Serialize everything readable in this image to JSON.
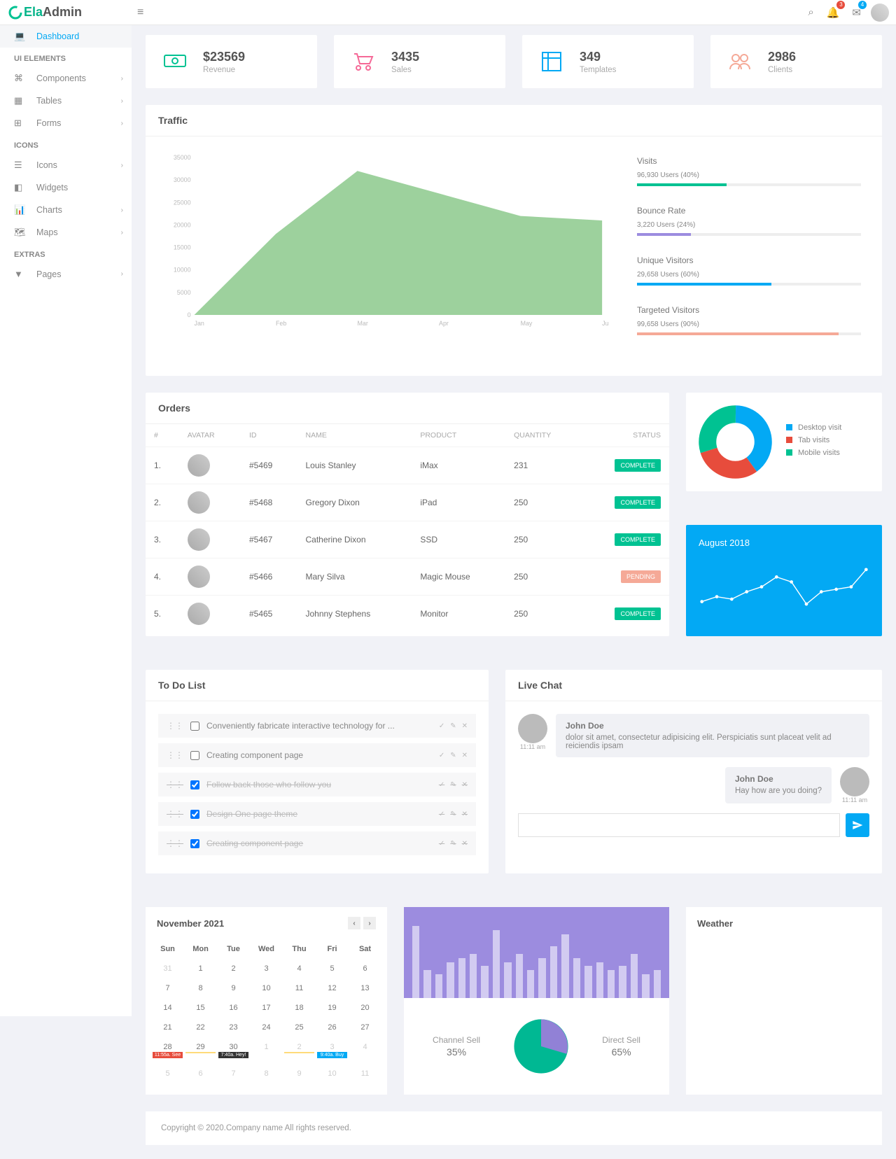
{
  "app": {
    "logo_front": "Ela",
    "logo_back": "Admin"
  },
  "badges": {
    "bell": "3",
    "mail": "4"
  },
  "sidebar": {
    "dashboard": "Dashboard",
    "groups": [
      {
        "title": "UI ELEMENTS",
        "items": [
          {
            "label": "Components",
            "chev": true,
            "icon": "⌘"
          },
          {
            "label": "Tables",
            "chev": true,
            "icon": "▦"
          },
          {
            "label": "Forms",
            "chev": true,
            "icon": "⊞"
          }
        ]
      },
      {
        "title": "ICONS",
        "items": [
          {
            "label": "Icons",
            "chev": true,
            "icon": "☰"
          },
          {
            "label": "Widgets",
            "chev": false,
            "icon": "◧"
          },
          {
            "label": "Charts",
            "chev": true,
            "icon": "📊"
          },
          {
            "label": "Maps",
            "chev": true,
            "icon": "🗺"
          }
        ]
      },
      {
        "title": "EXTRAS",
        "items": [
          {
            "label": "Pages",
            "chev": true,
            "icon": "▼"
          }
        ]
      }
    ]
  },
  "stats": [
    {
      "value": "$23569",
      "label": "Revenue",
      "color": "#00c292"
    },
    {
      "value": "3435",
      "label": "Sales",
      "color": "#f56997"
    },
    {
      "value": "349",
      "label": "Templates",
      "color": "#03a9f4"
    },
    {
      "value": "2986",
      "label": "Clients",
      "color": "#f5a997"
    }
  ],
  "traffic": {
    "title": "Traffic",
    "metrics": [
      {
        "title": "Visits",
        "text": "96,930 Users (40%)",
        "pct": 40,
        "color": "#00c292"
      },
      {
        "title": "Bounce Rate",
        "text": "3,220 Users (24%)",
        "pct": 24,
        "color": "#9c8cdf"
      },
      {
        "title": "Unique Visitors",
        "text": "29,658 Users (60%)",
        "pct": 60,
        "color": "#03a9f4"
      },
      {
        "title": "Targeted Visitors",
        "text": "99,658 Users (90%)",
        "pct": 90,
        "color": "#f5a997"
      }
    ]
  },
  "chart_data": {
    "traffic_area": {
      "type": "area",
      "ylim": [
        0,
        35000
      ],
      "yticks": [
        0,
        5000,
        10000,
        15000,
        20000,
        25000,
        30000,
        35000
      ],
      "categories": [
        "Jan",
        "Feb",
        "Mar",
        "Apr",
        "May",
        "Jun"
      ],
      "values": [
        0,
        18000,
        32000,
        27000,
        22000,
        21000
      ]
    },
    "donut": {
      "type": "pie",
      "series": [
        {
          "name": "Desktop visit",
          "value": 40,
          "color": "#03a9f4"
        },
        {
          "name": "Tab visits",
          "value": 30,
          "color": "#e74c3c"
        },
        {
          "name": "Mobile visits",
          "value": 30,
          "color": "#00c292"
        }
      ]
    },
    "august_line": {
      "type": "line",
      "title": "August 2018",
      "values": [
        30,
        40,
        35,
        50,
        60,
        80,
        70,
        25,
        50,
        55,
        60,
        95
      ]
    },
    "bars": {
      "type": "bar",
      "values": [
        90,
        35,
        30,
        45,
        50,
        55,
        40,
        85,
        45,
        55,
        35,
        50,
        65,
        80,
        50,
        40,
        45,
        35,
        40,
        55,
        30,
        35
      ]
    },
    "sell_pie": {
      "type": "pie",
      "series": [
        {
          "name": "Channel Sell",
          "label": "35%",
          "value": 35,
          "color": "#9181d6"
        },
        {
          "name": "Direct Sell",
          "label": "65%",
          "value": 65,
          "color": "#00b893"
        }
      ]
    }
  },
  "orders": {
    "title": "Orders",
    "columns": [
      "#",
      "AVATAR",
      "ID",
      "NAME",
      "PRODUCT",
      "QUANTITY",
      "STATUS"
    ],
    "rows": [
      {
        "n": "1.",
        "id": "#5469",
        "name": "Louis Stanley",
        "product": "iMax",
        "qty": "231",
        "status": "COMPLETE",
        "cls": "sb-green"
      },
      {
        "n": "2.",
        "id": "#5468",
        "name": "Gregory Dixon",
        "product": "iPad",
        "qty": "250",
        "status": "COMPLETE",
        "cls": "sb-green"
      },
      {
        "n": "3.",
        "id": "#5467",
        "name": "Catherine Dixon",
        "product": "SSD",
        "qty": "250",
        "status": "COMPLETE",
        "cls": "sb-green"
      },
      {
        "n": "4.",
        "id": "#5466",
        "name": "Mary Silva",
        "product": "Magic Mouse",
        "qty": "250",
        "status": "PENDING",
        "cls": "sb-orange"
      },
      {
        "n": "5.",
        "id": "#5465",
        "name": "Johnny Stephens",
        "product": "Monitor",
        "qty": "250",
        "status": "COMPLETE",
        "cls": "sb-green"
      }
    ]
  },
  "todo": {
    "title": "To Do List",
    "items": [
      {
        "text": "Conveniently fabricate interactive technology for ...",
        "done": false
      },
      {
        "text": "Creating component page",
        "done": false
      },
      {
        "text": "Follow back those who follow you",
        "done": true
      },
      {
        "text": "Design One page theme",
        "done": true
      },
      {
        "text": "Creating component page",
        "done": true
      }
    ]
  },
  "chat": {
    "title": "Live Chat",
    "messages": [
      {
        "name": "John Doe",
        "time": "11:11 am",
        "text": "dolor sit amet, consectetur adipisicing elit. Perspiciatis sunt placeat velit ad reiciendis ipsam",
        "side": "left"
      },
      {
        "name": "John Doe",
        "time": "11:11 am",
        "text": "Hay how are you doing?",
        "side": "right"
      }
    ]
  },
  "calendar": {
    "title": "November 2021",
    "dows": [
      "Sun",
      "Mon",
      "Tue",
      "Wed",
      "Thu",
      "Fri",
      "Sat"
    ],
    "days": [
      {
        "d": "31",
        "m": 1
      },
      {
        "d": "1"
      },
      {
        "d": "2"
      },
      {
        "d": "3"
      },
      {
        "d": "4"
      },
      {
        "d": "5"
      },
      {
        "d": "6"
      },
      {
        "d": "7"
      },
      {
        "d": "8"
      },
      {
        "d": "9"
      },
      {
        "d": "10"
      },
      {
        "d": "11"
      },
      {
        "d": "12"
      },
      {
        "d": "13"
      },
      {
        "d": "14"
      },
      {
        "d": "15"
      },
      {
        "d": "16"
      },
      {
        "d": "17"
      },
      {
        "d": "18"
      },
      {
        "d": "19"
      },
      {
        "d": "20"
      },
      {
        "d": "21"
      },
      {
        "d": "22"
      },
      {
        "d": "23"
      },
      {
        "d": "24"
      },
      {
        "d": "25"
      },
      {
        "d": "26"
      },
      {
        "d": "27"
      },
      {
        "d": "28",
        "e": [
          {
            "c": "#e74c3c",
            "t": "11:55a. See"
          }
        ]
      },
      {
        "d": "29",
        "e": [
          {
            "c": "#ffdb7a",
            "t": " "
          }
        ]
      },
      {
        "d": "30",
        "e": [
          {
            "c": "#333",
            "t": "7:40a. Hey!"
          }
        ]
      },
      {
        "d": "1",
        "m": 1
      },
      {
        "d": "2",
        "m": 1,
        "e": [
          {
            "c": "#ffdb7a",
            "t": " "
          }
        ]
      },
      {
        "d": "3",
        "m": 1,
        "e": [
          {
            "c": "#03a9f4",
            "t": "9:40a. Buy"
          }
        ]
      },
      {
        "d": "4",
        "m": 1
      },
      {
        "d": "5",
        "m": 1
      },
      {
        "d": "6",
        "m": 1
      },
      {
        "d": "7",
        "m": 1
      },
      {
        "d": "8",
        "m": 1
      },
      {
        "d": "9",
        "m": 1
      },
      {
        "d": "10",
        "m": 1
      },
      {
        "d": "11",
        "m": 1
      }
    ]
  },
  "weather": {
    "title": "Weather"
  },
  "footer": "Copyright © 2020.Company name All rights reserved."
}
